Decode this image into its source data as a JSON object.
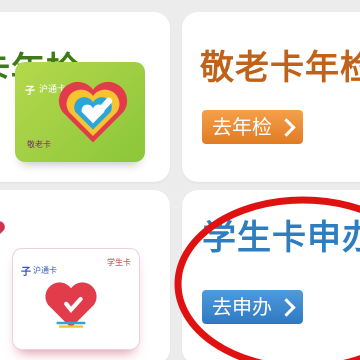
{
  "tiles": {
    "top_left": {
      "title": "卡年检",
      "card": {
        "logo": "子",
        "wordmark": "沪通卡",
        "subtitle": "敬老卡",
        "color_start": "#b5d84c",
        "color_end": "#8cc63a"
      }
    },
    "top_right": {
      "title": "敬老卡年检",
      "button_label": "去年检",
      "button_color": "#e17b23"
    },
    "bottom_left": {
      "card": {
        "logo": "子",
        "wordmark": "沪通卡",
        "tag": "学生卡",
        "glow_color": "#d2334b"
      }
    },
    "bottom_right": {
      "title": "学生卡申办",
      "button_label": "去申办",
      "button_color": "#2e79c2",
      "highlight_color": "#e01111"
    }
  },
  "icons": {
    "chevron": "chevron-right-icon",
    "heart_green": "heart-logo-icon",
    "heart_red": "heart-logo-icon"
  }
}
